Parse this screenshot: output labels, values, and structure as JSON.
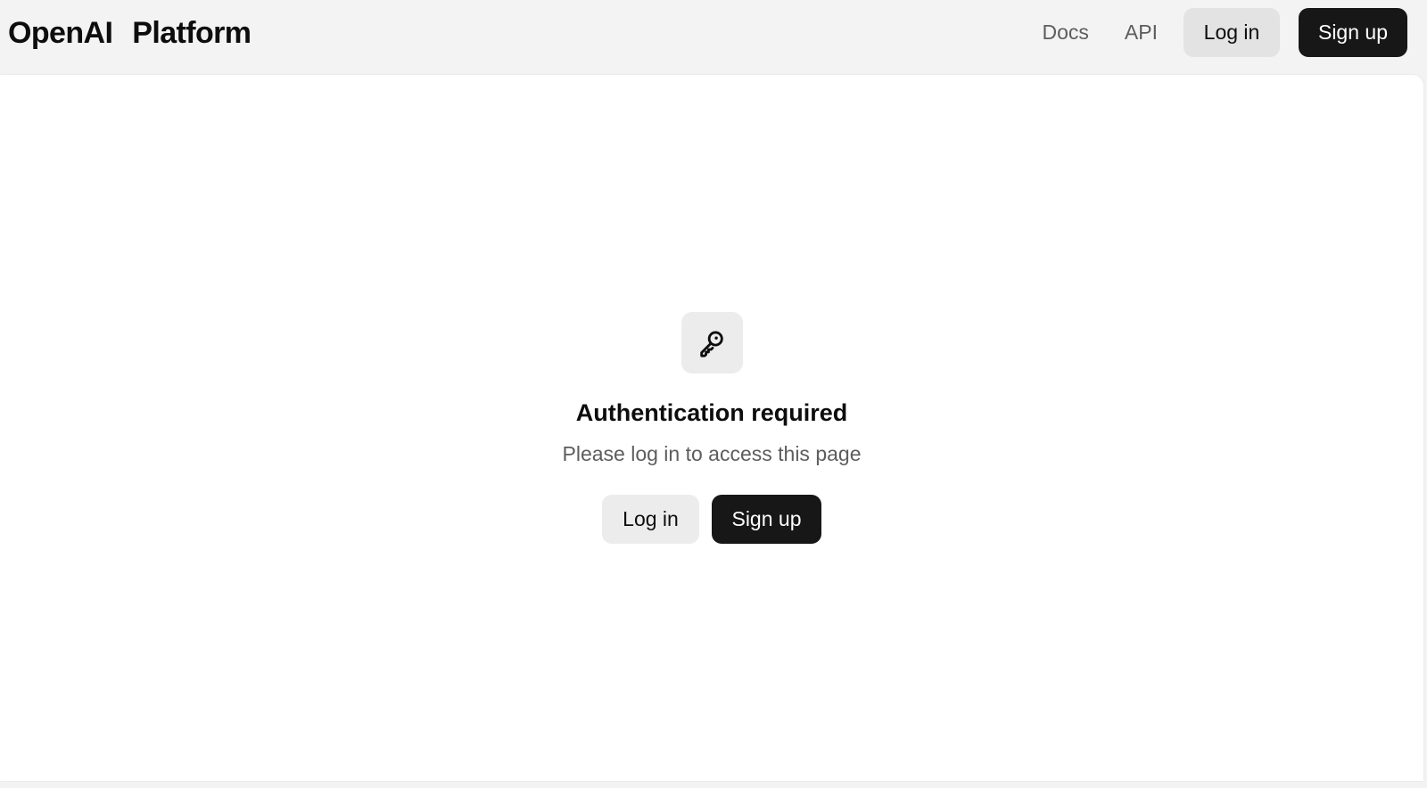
{
  "header": {
    "brand": {
      "company": "OpenAI",
      "product": "Platform"
    },
    "nav": {
      "docs": "Docs",
      "api": "API",
      "login": "Log in",
      "signup": "Sign up"
    }
  },
  "auth_prompt": {
    "icon": "key-icon",
    "title": "Authentication required",
    "message": "Please log in to access this page",
    "login": "Log in",
    "signup": "Sign up"
  },
  "colors": {
    "page_background": "#f3f3f3",
    "card_background": "#ffffff",
    "primary_button": "#171717",
    "secondary_button": "#e3e3e3",
    "muted_text": "#5d5d5d"
  }
}
